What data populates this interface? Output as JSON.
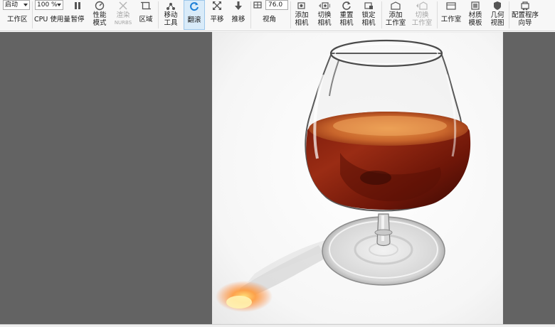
{
  "toolbar": {
    "start_dropdown": {
      "value": "启动"
    },
    "zoom_dropdown": {
      "value": "100 %"
    },
    "fov_value": "76.0",
    "buttons": {
      "workspace": "工作区",
      "cpu_usage": "CPU 使用量",
      "pause": "暂停",
      "performance_mode": [
        "性能",
        "模式"
      ],
      "render_nurbs": [
        "渲染",
        "NURBS"
      ],
      "region": "区域",
      "move_tool": [
        "移动",
        "工具"
      ],
      "tumble": "翻滚",
      "pan": "平移",
      "dolly": "推移",
      "field_of_view": "视角",
      "add_camera": [
        "添加",
        "相机"
      ],
      "switch_camera": [
        "切换",
        "相机"
      ],
      "reset_camera": [
        "重置",
        "相机"
      ],
      "lock_camera": [
        "锁定",
        "相机"
      ],
      "add_studio": [
        "添加",
        "工作室"
      ],
      "switch_studio": [
        "切换",
        "工作室"
      ],
      "studio": "工作室",
      "material_template": [
        "材质",
        "模板"
      ],
      "geometry_view": [
        "几何",
        "视图"
      ],
      "configuration_wizard": [
        "配置程序",
        "向导"
      ]
    }
  },
  "viewport": {
    "background_color": "#636363",
    "render_background_color": "#ffffff",
    "subject": "brandy-glass-render"
  },
  "colors": {
    "active_button_bg": "#d9ebf9",
    "active_icon": "#1e7fd6",
    "disabled_text": "#a5a5a5"
  }
}
